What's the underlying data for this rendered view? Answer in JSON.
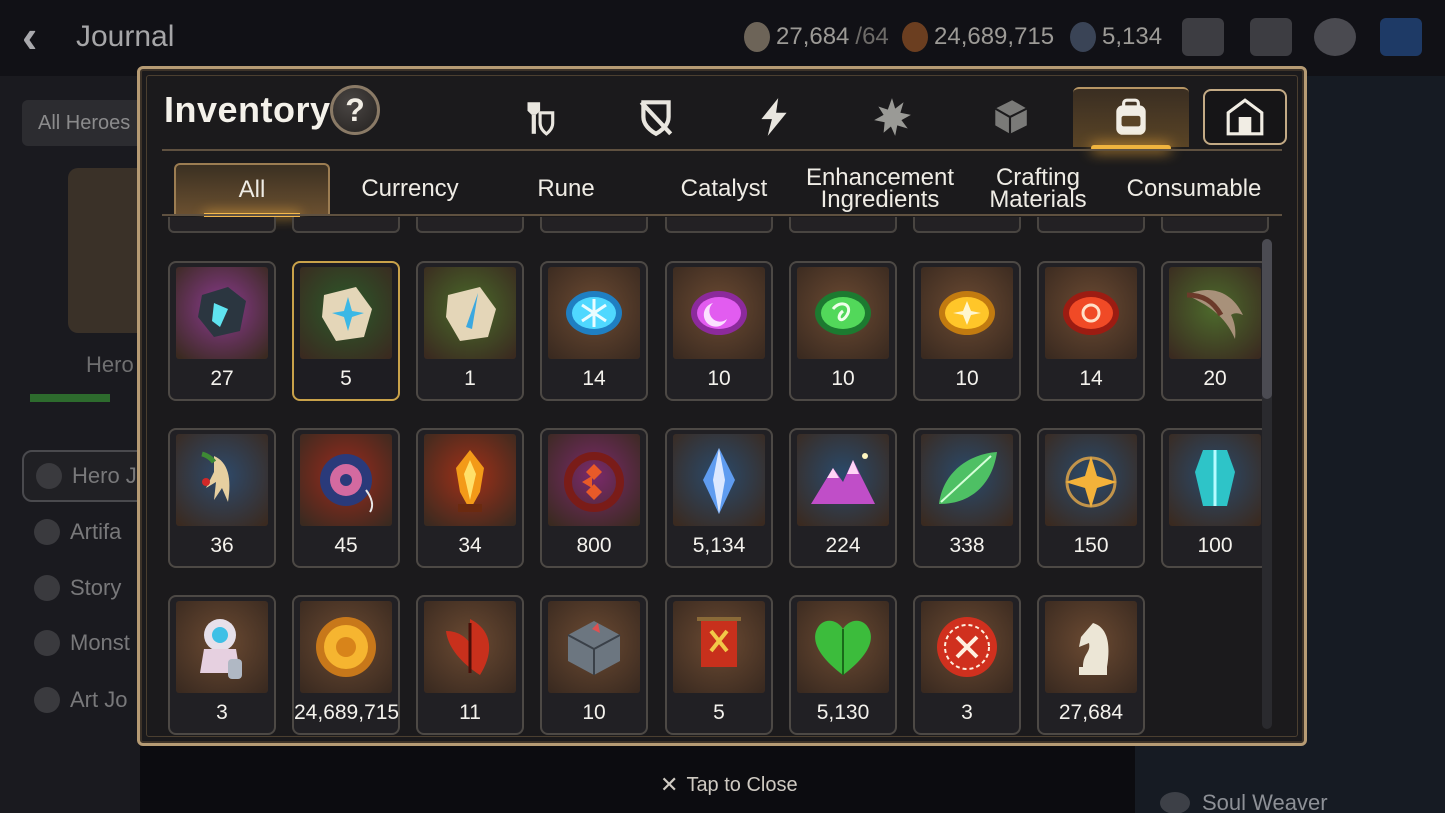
{
  "header": {
    "title": "Journal",
    "resources": [
      {
        "icon": "skystone-icon",
        "value": "27,684",
        "max": "/64"
      },
      {
        "icon": "gold-icon",
        "value": "24,689,715",
        "max": ""
      },
      {
        "icon": "crystal-icon",
        "value": "5,134",
        "max": ""
      }
    ]
  },
  "background": {
    "filter_label": "All Heroes",
    "hero_label": "Hero",
    "nav_items": [
      "Hero J",
      "Artifa",
      "Story",
      "Monst",
      "Art Jo"
    ],
    "bottom_right_label": "Soul Weaver"
  },
  "inventory": {
    "title": "Inventory",
    "help_label": "?",
    "category_tabs": [
      {
        "icon": "hero-equipment-icon",
        "active": false
      },
      {
        "icon": "artifact-shield-icon",
        "active": false
      },
      {
        "icon": "lightning-icon",
        "active": false
      },
      {
        "icon": "splash-icon",
        "active": false
      },
      {
        "icon": "cube-icon",
        "active": false
      },
      {
        "icon": "backpack-icon",
        "active": true
      },
      {
        "icon": "storage-house-icon",
        "active": false
      }
    ],
    "sub_tabs": [
      {
        "label": "All",
        "active": true
      },
      {
        "label": "Currency",
        "active": false
      },
      {
        "label": "Rune",
        "active": false
      },
      {
        "label": "Catalyst",
        "active": false
      },
      {
        "label": "Enhancement\nIngredients",
        "active": false
      },
      {
        "label": "Crafting\nMaterials",
        "active": false
      },
      {
        "label": "Consumable",
        "active": false
      }
    ],
    "items": [
      {
        "icon": "dark-rune-stone-icon",
        "count": "27",
        "bg": "#8a3a8e"
      },
      {
        "icon": "star-rune-stone-icon",
        "count": "5",
        "bg": "#2c5a2a"
      },
      {
        "icon": "blade-rune-stone-icon",
        "count": "1",
        "bg": "#4a6b2a"
      },
      {
        "icon": "ice-gem-icon",
        "count": "14",
        "bg": "#6b4a32"
      },
      {
        "icon": "moon-gem-icon",
        "count": "10",
        "bg": "#6b4a32"
      },
      {
        "icon": "wind-gem-icon",
        "count": "10",
        "bg": "#6b4a32"
      },
      {
        "icon": "sun-gem-icon",
        "count": "10",
        "bg": "#6b4a32"
      },
      {
        "icon": "fire-gem-icon",
        "count": "14",
        "bg": "#6b4a32"
      },
      {
        "icon": "claw-icon",
        "count": "20",
        "bg": "#4d6b2c"
      },
      {
        "icon": "ginseng-icon",
        "count": "36",
        "bg": "#2e4a6b"
      },
      {
        "icon": "yoyo-icon",
        "count": "45",
        "bg": "#9b2a1c"
      },
      {
        "icon": "flame-crystal-icon",
        "count": "34",
        "bg": "#a03018"
      },
      {
        "icon": "red-ring-icon",
        "count": "800",
        "bg": "#7a2a6a"
      },
      {
        "icon": "crystal-shard-icon",
        "count": "5,134",
        "bg": "#2a4a6b"
      },
      {
        "icon": "pink-mountain-icon",
        "count": "224",
        "bg": "#2a4a6b"
      },
      {
        "icon": "leaf-icon",
        "count": "338",
        "bg": "#2a4a6b"
      },
      {
        "icon": "star-pendant-icon",
        "count": "150",
        "bg": "#2a4a6b"
      },
      {
        "icon": "cyan-crystal-icon",
        "count": "100",
        "bg": "#2a4a6b"
      },
      {
        "icon": "doll-icon",
        "count": "3",
        "bg": "#6b4a32"
      },
      {
        "icon": "gold-coin-icon",
        "count": "24,689,715",
        "bg": "#6b4a32"
      },
      {
        "icon": "red-leaf-icon",
        "count": "11",
        "bg": "#6b4a32"
      },
      {
        "icon": "stone-block-icon",
        "count": "10",
        "bg": "#6b4a32"
      },
      {
        "icon": "banner-icon",
        "count": "5",
        "bg": "#6b4a32"
      },
      {
        "icon": "green-heart-icon",
        "count": "5,130",
        "bg": "#6b4a32"
      },
      {
        "icon": "red-badge-icon",
        "count": "3",
        "bg": "#6b4a32"
      },
      {
        "icon": "chess-knight-icon",
        "count": "27,684",
        "bg": "#6b4a32"
      }
    ]
  },
  "close_hint": "Tap to Close",
  "colors": {
    "accent": "#f0b43e",
    "frame": "#b69b74"
  }
}
